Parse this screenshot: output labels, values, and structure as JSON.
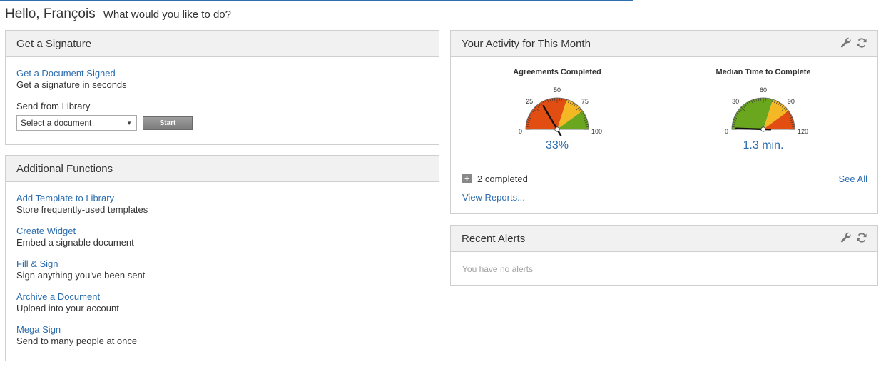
{
  "greeting": {
    "hello": "Hello, François",
    "question": "What would you like to do?"
  },
  "get_signature": {
    "title": "Get a Signature",
    "link": "Get a Document Signed",
    "desc": "Get a signature in seconds",
    "library_label": "Send from Library",
    "select_value": "Select a document",
    "start_label": "Start"
  },
  "additional": {
    "title": "Additional Functions",
    "items": [
      {
        "link": "Add Template to Library",
        "desc": "Store frequently-used templates"
      },
      {
        "link": "Create Widget",
        "desc": "Embed a signable document"
      },
      {
        "link": "Fill & Sign",
        "desc": "Sign anything you've been sent"
      },
      {
        "link": "Archive a Document",
        "desc": "Upload into your account"
      },
      {
        "link": "Mega Sign",
        "desc": "Send to many people at once"
      }
    ]
  },
  "activity": {
    "title": "Your Activity for This Month",
    "gauges": [
      {
        "title": "Agreements Completed",
        "value": "33%",
        "ticks": [
          "0",
          "25",
          "50",
          "75",
          "100"
        ],
        "reading": 33,
        "max": 100,
        "bands": [
          "#e24e12",
          "#f5b825",
          "#6aa61e"
        ]
      },
      {
        "title": "Median Time to Complete",
        "value": "1.3 min.",
        "ticks": [
          "0",
          "30",
          "60",
          "90",
          "120"
        ],
        "reading": 1.3,
        "max": 120,
        "bands": [
          "#6aa61e",
          "#f5b825",
          "#e24e12"
        ]
      }
    ],
    "completed": "2 completed",
    "see_all": "See All",
    "view_reports": "View Reports..."
  },
  "alerts": {
    "title": "Recent Alerts",
    "empty": "You have no alerts"
  },
  "icons": {
    "wrench": "wrench-icon",
    "refresh": "refresh-icon",
    "plus": "plus-icon",
    "dropdown": "chevron-down-icon"
  },
  "colors": {
    "link": "#2b6dae",
    "top_rule": "#2f6fb0"
  }
}
